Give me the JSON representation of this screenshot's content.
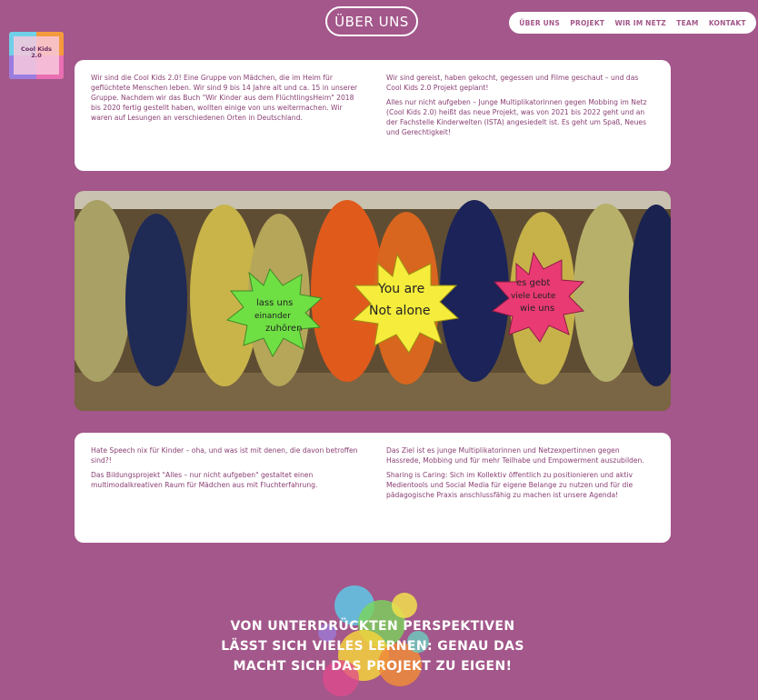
{
  "header": {
    "section_title": "ÜBER UNS",
    "nav": [
      "ÜBER UNS",
      "PROJEKT",
      "WIR IM NETZ",
      "TEAM",
      "KONTAKT"
    ]
  },
  "logo": {
    "text_line1": "Cool Kids",
    "text_line2": "2.0"
  },
  "intro": {
    "left": [
      "Wir sind die Cool Kids 2.0! Eine Gruppe von Mädchen, die im Heim für geflüchtete Menschen leben. Wir sind 9 bis 14 Jahre alt und ca. 15 in unserer Gruppe. Nachdem wir das Buch \"Wir Kinder aus dem FlüchtlingsHeim\" 2018 bis 2020 fertig gestellt haben, wollten einige von uns weitermachen. Wir waren auf Lesungen an verschiedenen Orten in Deutschland."
    ],
    "right": [
      "Wir sind gereist, haben gekocht, gegessen und Filme geschaut – und das Cool Kids 2.0 Projekt geplant!",
      "Alles nur nicht aufgeben – Junge Multiplikatorinnen gegen Mobbing im Netz (Cool Kids 2.0) heißt das neue Projekt, was von 2021 bis 2022 geht und an der Fachstelle Kinderwelten (ISTA) angesiedelt ist. Es geht um Spaß, Neues und Gerechtigkeit!"
    ]
  },
  "photo": {
    "star1": [
      "lass uns",
      "einander",
      "zuhören"
    ],
    "star2": [
      "You are",
      "Not alone"
    ],
    "star3": [
      "es gebt",
      "viele Leute",
      "wie uns"
    ]
  },
  "project": {
    "left": [
      "Hate Speech nix für Kinder – oha, und was ist mit denen, die davon betroffen sind?!",
      "Das Bildungsprojekt \"Alles – nur nicht aufgeben\" gestaltet einen multimodalkreativen Raum für Mädchen aus mit Fluchterfahrung."
    ],
    "right": [
      "Das Ziel ist es junge Multiplikatorinnen und Netzexpertinnen gegen Hassrede, Mobbing und für mehr Teilhabe und Empowerment auszubilden.",
      "Sharing is Caring: Sich im Kollektiv öffentlich zu positionieren und aktiv Medientools und Social Media für eigene Belange zu nutzen und für die pädagogische Praxis anschlussfähig zu machen ist unsere Agenda!"
    ]
  },
  "headline": "VON UNTERDRÜCKTEN PERSPEKTIVEN LÄSST SICH VIELES LERNEN: GENAU DAS MACHT SICH DAS PROJEKT ZU EIGEN!",
  "colors": {
    "background": "#a3578a",
    "text": "#8a3f73",
    "card": "#ffffff"
  }
}
